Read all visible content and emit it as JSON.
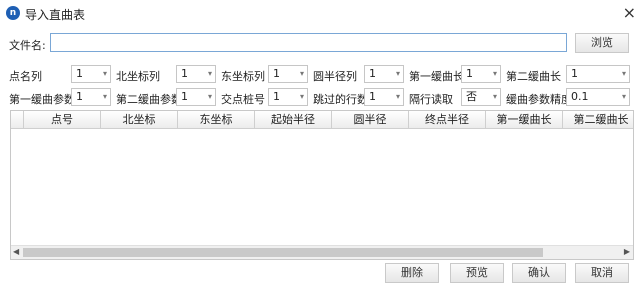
{
  "window": {
    "title": "导入直曲表",
    "app_icon": "app-logo-icon",
    "close_glyph": "×"
  },
  "file": {
    "label": "文件名:",
    "value": "",
    "browse_label": "浏览"
  },
  "options_row1": [
    {
      "label": "点名列",
      "value": "1"
    },
    {
      "label": "北坐标列",
      "value": "1"
    },
    {
      "label": "东坐标列",
      "value": "1"
    },
    {
      "label": "圆半径列",
      "value": "1"
    },
    {
      "label": "第一缓曲长",
      "value": "1"
    },
    {
      "label": "第二缓曲长",
      "value": "1"
    }
  ],
  "options_row2": [
    {
      "label": "第一缓曲参数",
      "value": "1"
    },
    {
      "label": "第二缓曲参数",
      "value": "1"
    },
    {
      "label": "交点桩号",
      "value": "1"
    },
    {
      "label": "跳过的行数",
      "value": "1"
    },
    {
      "label": "隔行读取",
      "value": "否"
    },
    {
      "label": "缓曲参数精度",
      "value": "0.1"
    }
  ],
  "table": {
    "columns": [
      "点号",
      "北坐标",
      "东坐标",
      "起始半径",
      "圆半径",
      "终点半径",
      "第一缓曲长",
      "第二缓曲长"
    ],
    "rows": []
  },
  "buttons": {
    "delete": "删除",
    "preview": "预览",
    "confirm": "确认",
    "cancel": "取消"
  },
  "colors": {
    "accent": "#1e5fb4",
    "input_border": "#7aa7d6"
  }
}
